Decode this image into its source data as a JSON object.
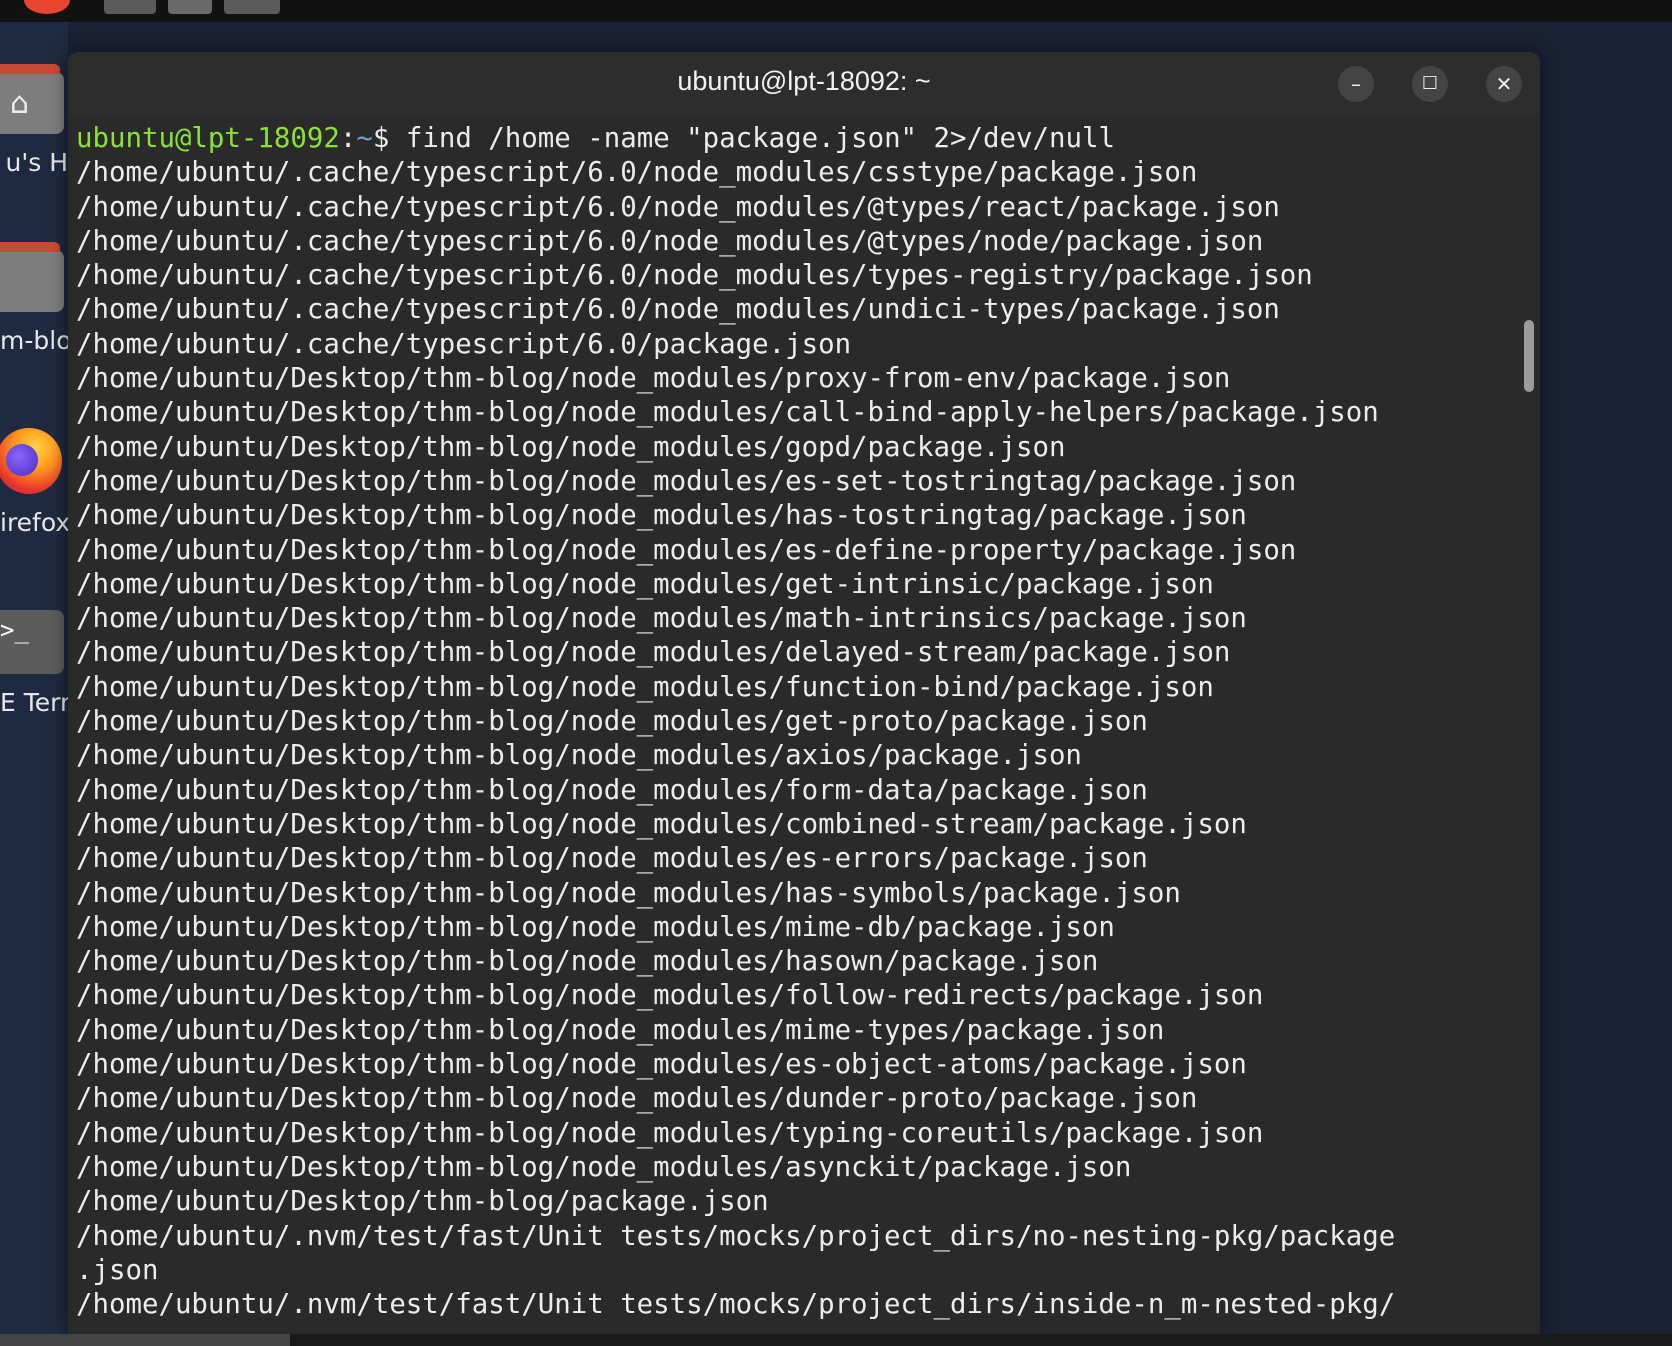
{
  "window": {
    "title": "ubuntu@lpt-18092: ~",
    "minimize_symbol": "–",
    "maximize_symbol": "☐",
    "close_symbol": "✕"
  },
  "desktop": {
    "icons": [
      {
        "label": "u's H",
        "icon": "home-folder-icon"
      },
      {
        "label": "m-blo",
        "icon": "folder-icon"
      },
      {
        "label": "irefox",
        "icon": "firefox-icon"
      },
      {
        "label": "E Tern",
        "icon": "terminal-icon"
      }
    ],
    "terminal_glyph": ">_",
    "home_glyph": "⌂"
  },
  "terminal": {
    "prompt_user": "ubuntu@lpt-18092",
    "prompt_sep": ":",
    "prompt_path": "~",
    "prompt_symbol": "$ ",
    "command": "find /home -name \"package.json\" 2>/dev/null",
    "output": [
      "/home/ubuntu/.cache/typescript/6.0/node_modules/csstype/package.json",
      "/home/ubuntu/.cache/typescript/6.0/node_modules/@types/react/package.json",
      "/home/ubuntu/.cache/typescript/6.0/node_modules/@types/node/package.json",
      "/home/ubuntu/.cache/typescript/6.0/node_modules/types-registry/package.json",
      "/home/ubuntu/.cache/typescript/6.0/node_modules/undici-types/package.json",
      "/home/ubuntu/.cache/typescript/6.0/package.json",
      "/home/ubuntu/Desktop/thm-blog/node_modules/proxy-from-env/package.json",
      "/home/ubuntu/Desktop/thm-blog/node_modules/call-bind-apply-helpers/package.json",
      "/home/ubuntu/Desktop/thm-blog/node_modules/gopd/package.json",
      "/home/ubuntu/Desktop/thm-blog/node_modules/es-set-tostringtag/package.json",
      "/home/ubuntu/Desktop/thm-blog/node_modules/has-tostringtag/package.json",
      "/home/ubuntu/Desktop/thm-blog/node_modules/es-define-property/package.json",
      "/home/ubuntu/Desktop/thm-blog/node_modules/get-intrinsic/package.json",
      "/home/ubuntu/Desktop/thm-blog/node_modules/math-intrinsics/package.json",
      "/home/ubuntu/Desktop/thm-blog/node_modules/delayed-stream/package.json",
      "/home/ubuntu/Desktop/thm-blog/node_modules/function-bind/package.json",
      "/home/ubuntu/Desktop/thm-blog/node_modules/get-proto/package.json",
      "/home/ubuntu/Desktop/thm-blog/node_modules/axios/package.json",
      "/home/ubuntu/Desktop/thm-blog/node_modules/form-data/package.json",
      "/home/ubuntu/Desktop/thm-blog/node_modules/combined-stream/package.json",
      "/home/ubuntu/Desktop/thm-blog/node_modules/es-errors/package.json",
      "/home/ubuntu/Desktop/thm-blog/node_modules/has-symbols/package.json",
      "/home/ubuntu/Desktop/thm-blog/node_modules/mime-db/package.json",
      "/home/ubuntu/Desktop/thm-blog/node_modules/hasown/package.json",
      "/home/ubuntu/Desktop/thm-blog/node_modules/follow-redirects/package.json",
      "/home/ubuntu/Desktop/thm-blog/node_modules/mime-types/package.json",
      "/home/ubuntu/Desktop/thm-blog/node_modules/es-object-atoms/package.json",
      "/home/ubuntu/Desktop/thm-blog/node_modules/dunder-proto/package.json",
      "/home/ubuntu/Desktop/thm-blog/node_modules/typing-coreutils/package.json",
      "/home/ubuntu/Desktop/thm-blog/node_modules/asynckit/package.json",
      "/home/ubuntu/Desktop/thm-blog/package.json",
      "/home/ubuntu/.nvm/test/fast/Unit tests/mocks/project_dirs/no-nesting-pkg/package",
      ".json",
      "/home/ubuntu/.nvm/test/fast/Unit tests/mocks/project_dirs/inside-n_m-nested-pkg/"
    ]
  },
  "colors": {
    "prompt_user": "#8ae234",
    "prompt_path": "#729fcf",
    "terminal_bg": "#2a2a2a",
    "text": "#ececec"
  }
}
